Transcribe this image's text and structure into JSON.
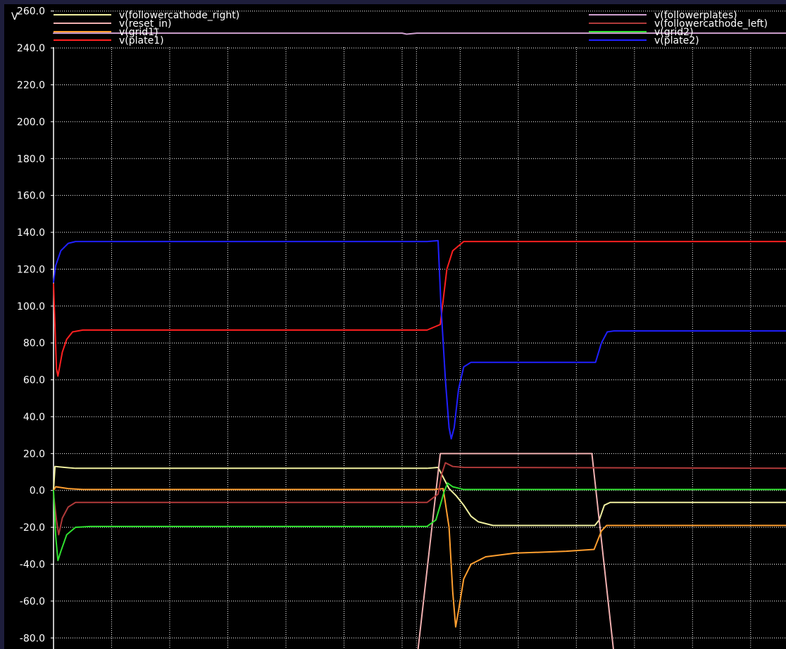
{
  "chart_data": {
    "type": "line",
    "y_unit": "V",
    "ylim": [
      -86,
      266
    ],
    "xlim": [
      0,
      100
    ],
    "grid": true,
    "legend_placement": "top",
    "y_ticks": [
      "260.0",
      "240.0",
      "220.0",
      "200.0",
      "180.0",
      "160.0",
      "140.0",
      "120.0",
      "100.0",
      "80.0",
      "60.0",
      "40.0",
      "20.0",
      "0.0",
      "-20.0",
      "-40.0",
      "-60.0",
      "-80.0"
    ],
    "x_gridlines": [
      7.93,
      15.86,
      23.79,
      31.73,
      39.66,
      47.59,
      49.55,
      55.52,
      63.45,
      71.38,
      79.31,
      87.24,
      95.17
    ],
    "series": [
      {
        "name": "v(followercathode_right)",
        "color": "#f0f0a0",
        "points": [
          [
            0,
            0
          ],
          [
            0.2,
            13
          ],
          [
            1.5,
            12.5
          ],
          [
            3,
            12
          ],
          [
            51,
            12
          ],
          [
            52.5,
            12.5
          ],
          [
            54,
            1
          ],
          [
            55,
            -3
          ],
          [
            56,
            -8
          ],
          [
            57,
            -14
          ],
          [
            58,
            -17
          ],
          [
            60,
            -19
          ],
          [
            70,
            -19
          ],
          [
            73.9,
            -19
          ],
          [
            74.5,
            -16
          ],
          [
            75.2,
            -8
          ],
          [
            76,
            -6.5
          ],
          [
            77.5,
            -6.5
          ],
          [
            100,
            -6.5
          ]
        ]
      },
      {
        "name": "v(reset_in)",
        "color": "#f0b0b0",
        "points": [
          [
            49.6,
            -92
          ],
          [
            52.8,
            20
          ],
          [
            73.5,
            20
          ],
          [
            76.6,
            -92
          ]
        ]
      },
      {
        "name": "v(grid1)",
        "color": "#ff9f30",
        "points": [
          [
            0,
            0
          ],
          [
            0.3,
            2
          ],
          [
            2,
            1
          ],
          [
            4,
            0.5
          ],
          [
            52,
            0.5
          ],
          [
            53.2,
            1
          ],
          [
            54,
            -20
          ],
          [
            54.5,
            -55
          ],
          [
            54.9,
            -74
          ],
          [
            55.3,
            -65
          ],
          [
            56,
            -48
          ],
          [
            57,
            -40
          ],
          [
            59,
            -36
          ],
          [
            63,
            -34
          ],
          [
            70,
            -33
          ],
          [
            73.8,
            -32
          ],
          [
            74.8,
            -22
          ],
          [
            75.5,
            -19
          ],
          [
            77,
            -19
          ],
          [
            100,
            -19
          ]
        ]
      },
      {
        "name": "v(plate1)",
        "color": "#ff2020",
        "points": [
          [
            0,
            112
          ],
          [
            0.4,
            66
          ],
          [
            0.6,
            62
          ],
          [
            1.2,
            75
          ],
          [
            1.8,
            82
          ],
          [
            2.6,
            86
          ],
          [
            4,
            87
          ],
          [
            48,
            87
          ],
          [
            51,
            87
          ],
          [
            52.8,
            90
          ],
          [
            53.1,
            100
          ],
          [
            53.7,
            120
          ],
          [
            54.5,
            130
          ],
          [
            56,
            135
          ],
          [
            60,
            135
          ],
          [
            100,
            135
          ]
        ]
      },
      {
        "name": "v(followerplates)",
        "color": "#d0a0d0",
        "points": [
          [
            0,
            248
          ],
          [
            47.6,
            248
          ],
          [
            48.2,
            247.5
          ],
          [
            49.6,
            248
          ],
          [
            100,
            248
          ]
        ]
      },
      {
        "name": "v(followercathode_left)",
        "color": "#b03a3a",
        "points": [
          [
            0,
            -2
          ],
          [
            0.4,
            -16
          ],
          [
            0.7,
            -24
          ],
          [
            1.2,
            -15
          ],
          [
            2,
            -9
          ],
          [
            3,
            -6.5
          ],
          [
            51,
            -6.5
          ],
          [
            52.5,
            -2
          ],
          [
            53,
            9
          ],
          [
            53.5,
            15
          ],
          [
            54.5,
            13
          ],
          [
            56,
            12.5
          ],
          [
            100,
            12
          ]
        ]
      },
      {
        "name": "v(grid2)",
        "color": "#30e030",
        "points": [
          [
            0,
            0
          ],
          [
            0.3,
            -25
          ],
          [
            0.6,
            -38
          ],
          [
            1,
            -33
          ],
          [
            1.8,
            -24
          ],
          [
            3,
            -20
          ],
          [
            5,
            -19.5
          ],
          [
            51,
            -19.5
          ],
          [
            52.2,
            -16
          ],
          [
            52.8,
            -8
          ],
          [
            53.3,
            -1
          ],
          [
            53.8,
            4
          ],
          [
            54.5,
            2
          ],
          [
            56,
            0.5
          ],
          [
            100,
            0.5
          ]
        ]
      },
      {
        "name": "v(plate2)",
        "color": "#2020ff",
        "points": [
          [
            0,
            113
          ],
          [
            0.3,
            122
          ],
          [
            1,
            130
          ],
          [
            2,
            134
          ],
          [
            3,
            135
          ],
          [
            51,
            135
          ],
          [
            52.5,
            135.5
          ],
          [
            52.9,
            100
          ],
          [
            53.5,
            60
          ],
          [
            54,
            34
          ],
          [
            54.3,
            28
          ],
          [
            54.7,
            34
          ],
          [
            55.3,
            55
          ],
          [
            56,
            67
          ],
          [
            57,
            69.5
          ],
          [
            74,
            69.5
          ],
          [
            74.8,
            80
          ],
          [
            75.6,
            86
          ],
          [
            76.5,
            86.5
          ],
          [
            100,
            86.5
          ]
        ]
      }
    ]
  }
}
